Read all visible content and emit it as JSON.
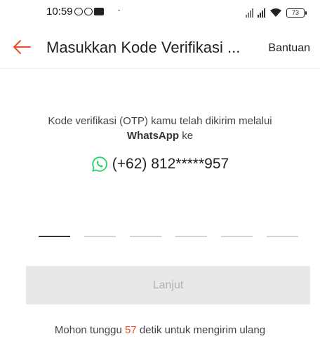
{
  "status_bar": {
    "time": "10:59",
    "battery_level": "73"
  },
  "header": {
    "title": "Masukkan Kode Verifikasi ...",
    "help_label": "Bantuan"
  },
  "message": {
    "line1": "Kode verifikasi (OTP) kamu telah dikirim melalui",
    "channel": "WhatsApp",
    "suffix": " ke",
    "phone": "(+62) 812*****957"
  },
  "otp": {
    "length": 6,
    "active_index": 0
  },
  "submit": {
    "label": "Lanjut",
    "enabled": false
  },
  "resend": {
    "prefix": "Mohon tunggu ",
    "seconds": "57",
    "suffix": " detik untuk mengirim ulang"
  },
  "colors": {
    "accent": "#ee4d2d",
    "whatsapp": "#25d366"
  }
}
